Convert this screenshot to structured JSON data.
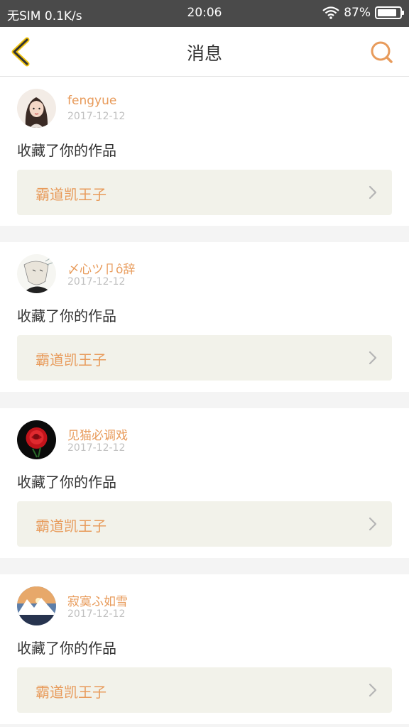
{
  "status_bar": {
    "carrier": "无SIM 0.1K/s",
    "time": "20:06",
    "battery": "87%",
    "battery_level": 0.87
  },
  "nav": {
    "title": "消息"
  },
  "colors": {
    "accent": "#e89b5b",
    "back_icon": "#f1c40f",
    "card_link_bg": "#f2f2ea",
    "status_bar_bg": "#4a4a4a"
  },
  "messages": [
    {
      "username": "fengyue",
      "date": "2017-12-12",
      "action": "收藏了你的作品",
      "work_title": "霸道凯王子",
      "avatar": "girl-portrait"
    },
    {
      "username": "〆心ツ卩ô辞",
      "date": "2017-12-12",
      "action": "收藏了你的作品",
      "work_title": "霸道凯王子",
      "avatar": "sketch-portrait"
    },
    {
      "username": "见猫必调戏",
      "date": "2017-12-12",
      "action": "收藏了你的作品",
      "work_title": "霸道凯王子",
      "avatar": "red-rose"
    },
    {
      "username": "寂寞ふ如雪",
      "date": "2017-12-12",
      "action": "收藏了你的作品",
      "work_title": "霸道凯王子",
      "avatar": "mountain-sunset"
    }
  ]
}
